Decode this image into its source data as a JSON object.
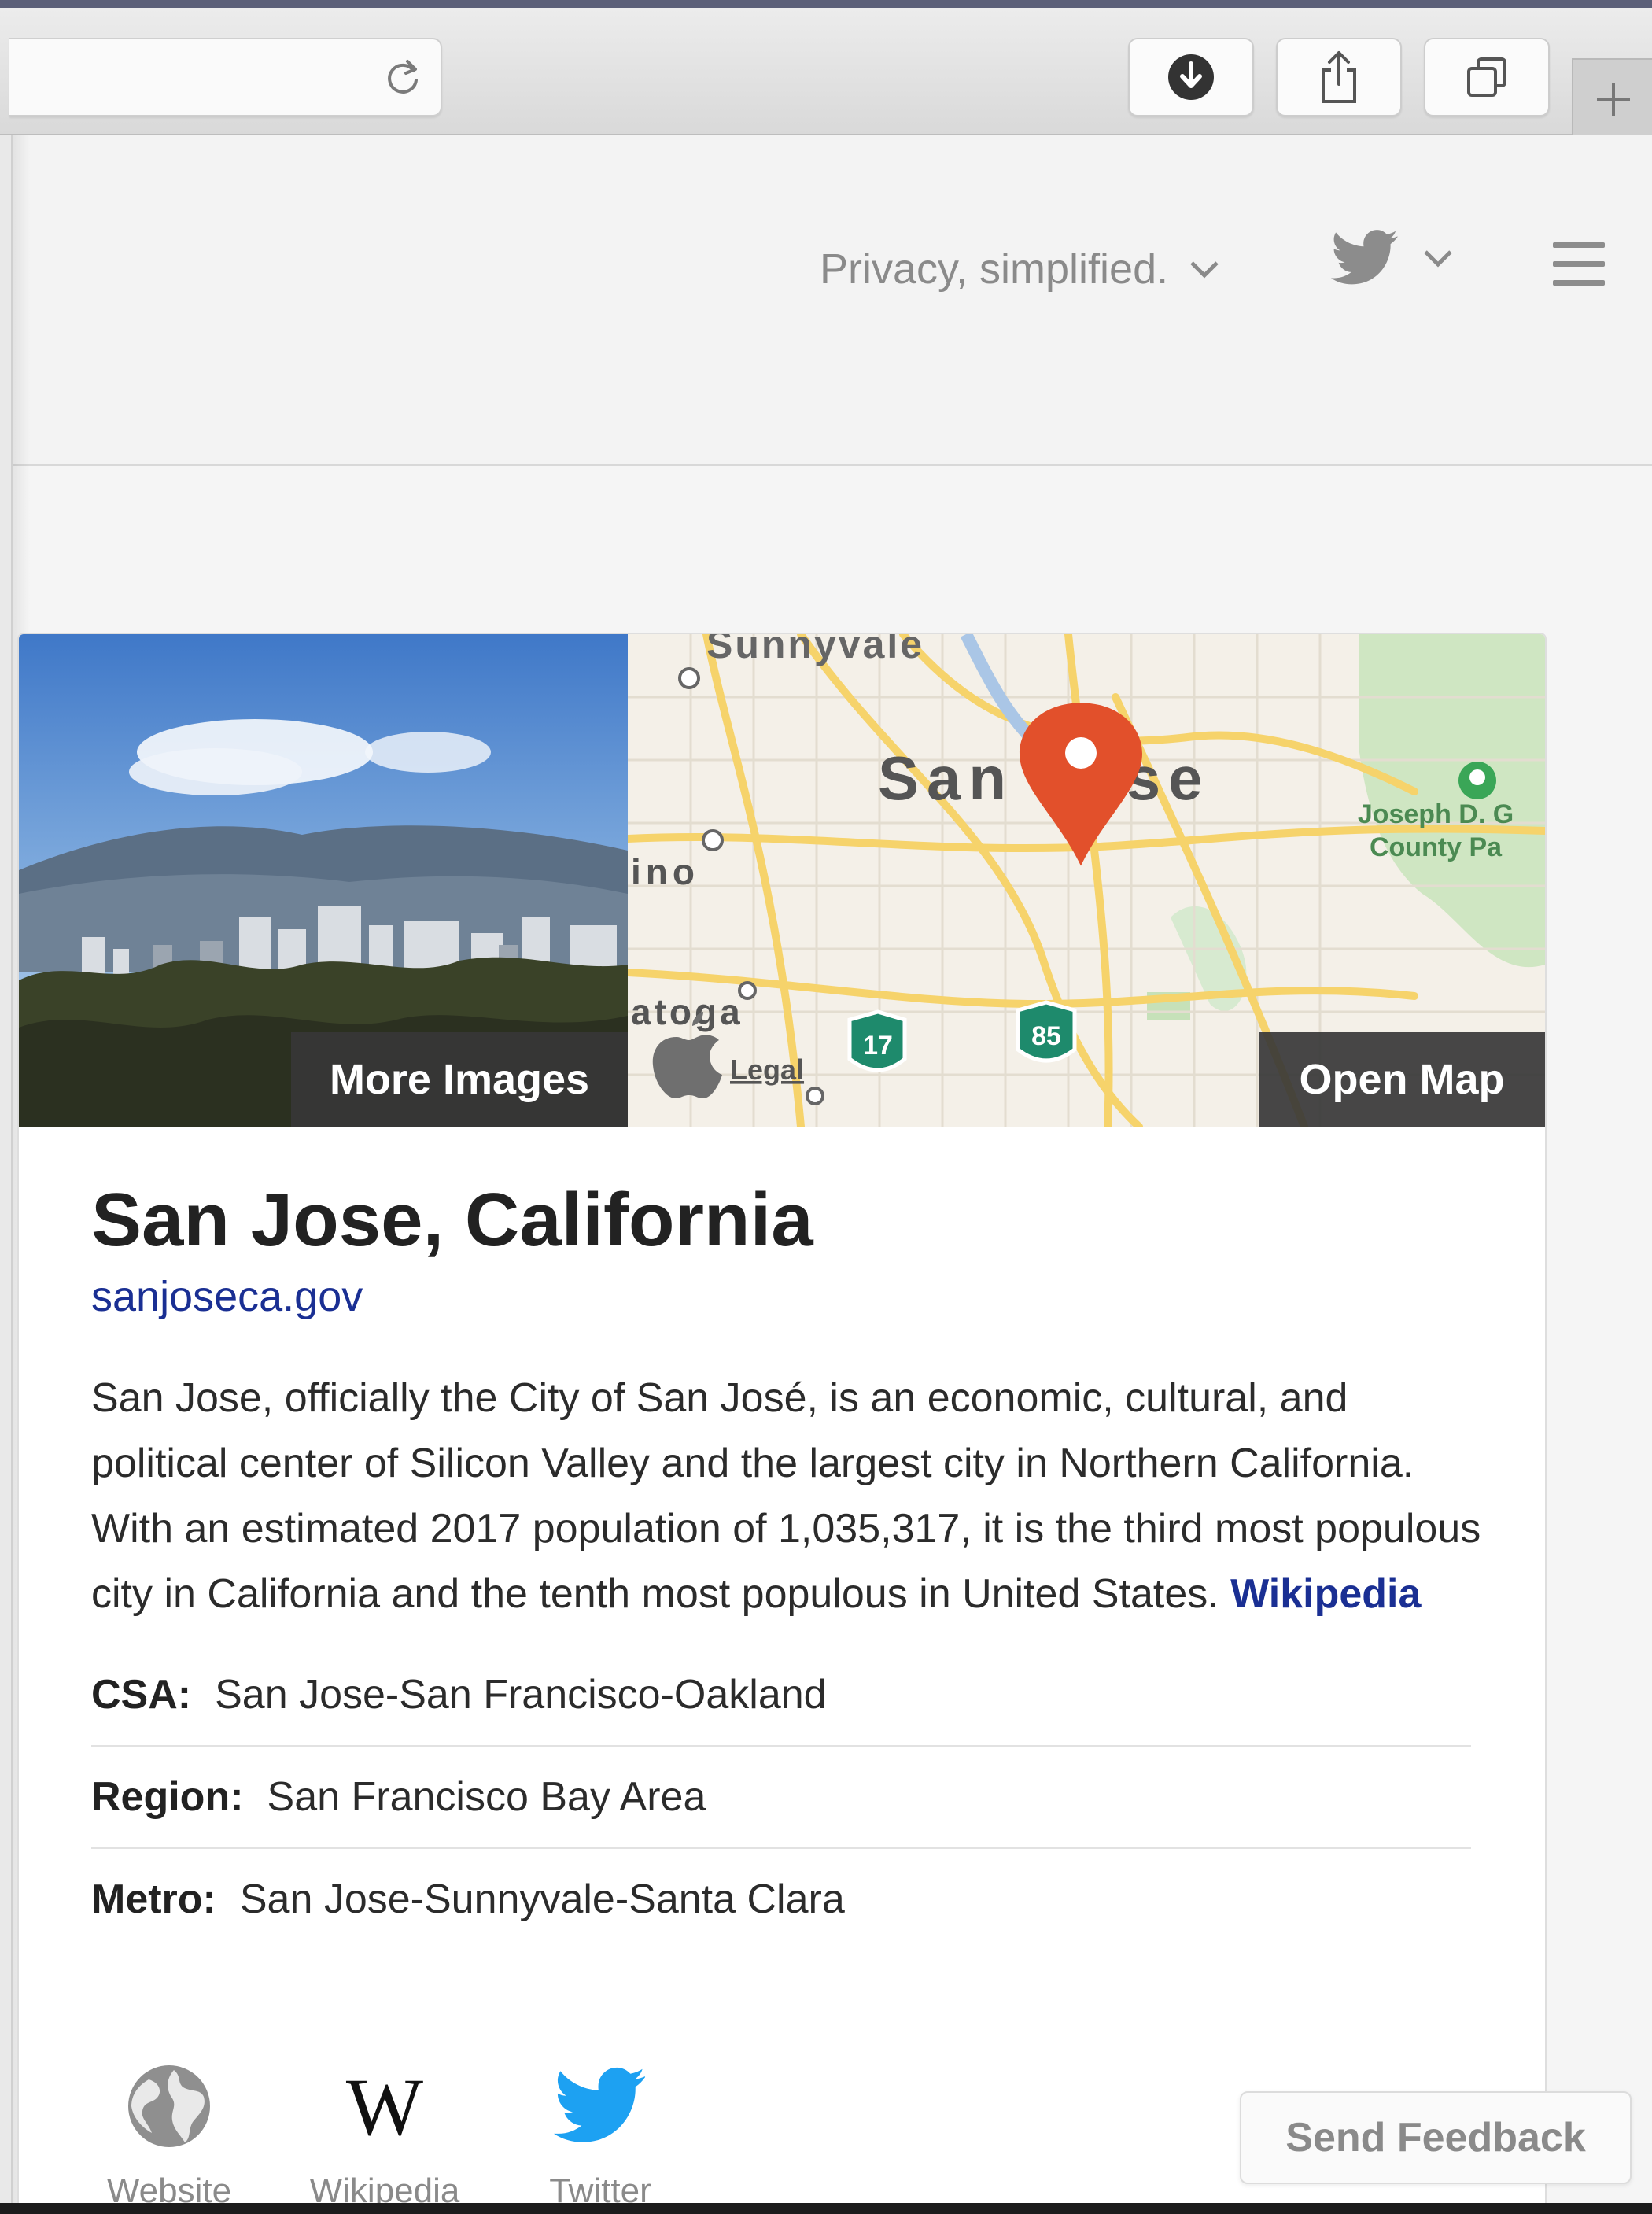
{
  "browser": {
    "icons": [
      "reload-icon",
      "download-icon",
      "share-icon",
      "tabs-icon",
      "new-tab-icon"
    ]
  },
  "header": {
    "privacy_label": "Privacy, simplified.",
    "social_icon": "twitter-icon",
    "menu_icon": "hamburger-icon"
  },
  "card": {
    "more_images": "More Images",
    "open_map": "Open Map",
    "map": {
      "labels": [
        "Sunnyvale",
        "San Jose",
        "Joseph D. G",
        "County Pa",
        "ino",
        "atoga",
        "Legal",
        "17",
        "85"
      ]
    },
    "title": "San Jose, California",
    "website": "sanjoseca.gov",
    "description": "San Jose, officially the City of San José, is an economic, cultural, and political center of Silicon Valley and the largest city in Northern California. With an estimated 2017 population of 1,035,317, it is the third most populous city in California and the tenth most populous in United States.",
    "source_link": "Wikipedia",
    "facts": [
      {
        "label": "CSA:",
        "value": "San Jose-San Francisco-Oakland"
      },
      {
        "label": "Region:",
        "value": "San Francisco Bay Area"
      },
      {
        "label": "Metro:",
        "value": "San Jose-Sunnyvale-Santa Clara"
      }
    ],
    "links": [
      {
        "label": "Website",
        "icon": "globe-icon"
      },
      {
        "label": "Wikipedia",
        "icon": "wikipedia-icon"
      },
      {
        "label": "Twitter",
        "icon": "twitter-icon"
      }
    ]
  },
  "feedback": "Send Feedback",
  "colors": {
    "link_blue": "#1a2f93",
    "twitter_blue": "#1da1f2",
    "map_pin": "#e2502b",
    "highway_green": "#1e8a6c"
  }
}
